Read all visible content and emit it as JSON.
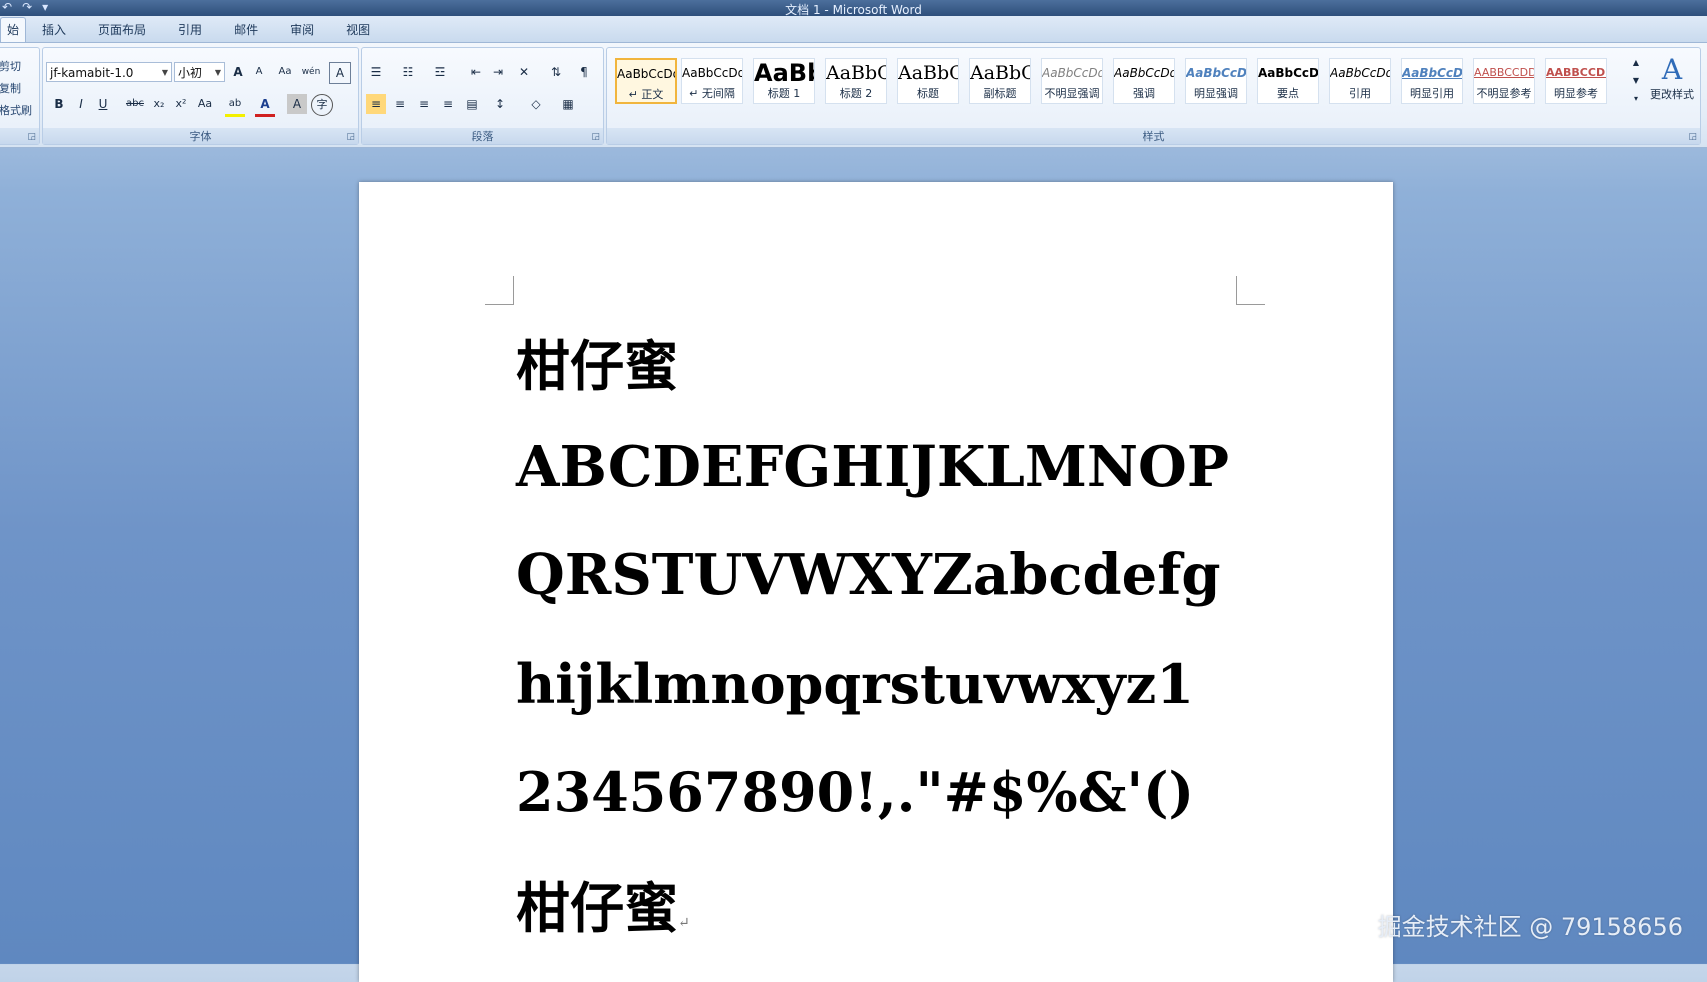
{
  "window": {
    "title": "文档 1 - Microsoft Word",
    "quick_access": [
      "↶",
      "↷",
      "▾"
    ]
  },
  "tabs": [
    {
      "label": "始"
    },
    {
      "label": "插入"
    },
    {
      "label": "页面布局"
    },
    {
      "label": "引用"
    },
    {
      "label": "邮件"
    },
    {
      "label": "审阅"
    },
    {
      "label": "视图"
    }
  ],
  "clipboard": {
    "items": [
      "剪切",
      "复制",
      "格式刷"
    ]
  },
  "font_group": {
    "label": "字体",
    "font_name": "jf-kamabit-1.0",
    "font_size": "小初",
    "buttons": [
      "A",
      "A",
      "Aa",
      "wén",
      "A",
      "B",
      "I",
      "U",
      "abc",
      "x₂",
      "x²",
      "Aa",
      "ab",
      "A",
      "A",
      "字"
    ]
  },
  "paragraph_group": {
    "label": "段落"
  },
  "styles_group": {
    "label": "样式",
    "styles": [
      {
        "sample": "AaBbCcDd",
        "label": "↵ 正文",
        "selected": true
      },
      {
        "sample": "AaBbCcDd",
        "label": "↵ 无间隔"
      },
      {
        "sample": "AaBb",
        "label": "标题 1"
      },
      {
        "sample": "AaBbC",
        "label": "标题 2"
      },
      {
        "sample": "AaBbC",
        "label": "标题"
      },
      {
        "sample": "AaBbC",
        "label": "副标题"
      },
      {
        "sample": "AaBbCcDd",
        "label": "不明显强调"
      },
      {
        "sample": "AaBbCcDd",
        "label": "强调"
      },
      {
        "sample": "AaBbCcDd",
        "label": "明显强调"
      },
      {
        "sample": "AaBbCcDd",
        "label": "要点"
      },
      {
        "sample": "AaBbCcDd",
        "label": "引用"
      },
      {
        "sample": "AaBbCcDd",
        "label": "明显引用"
      },
      {
        "sample": "AABBCCDD",
        "label": "不明显参考"
      },
      {
        "sample": "AABBCCDD",
        "label": "明显参考"
      }
    ],
    "change_styles": "更改样式"
  },
  "document": {
    "lines": [
      "柑仔蜜",
      "ABCDEFGHIJKLMNOP",
      "QRSTUVWXYZabcdefg",
      "hijklmnopqrstuvwxyz1",
      "234567890!,.\"#$%&'()",
      "柑仔蜜"
    ],
    "paragraph_mark": "↵"
  },
  "watermark": "掘金技术社区 @ 79158656"
}
